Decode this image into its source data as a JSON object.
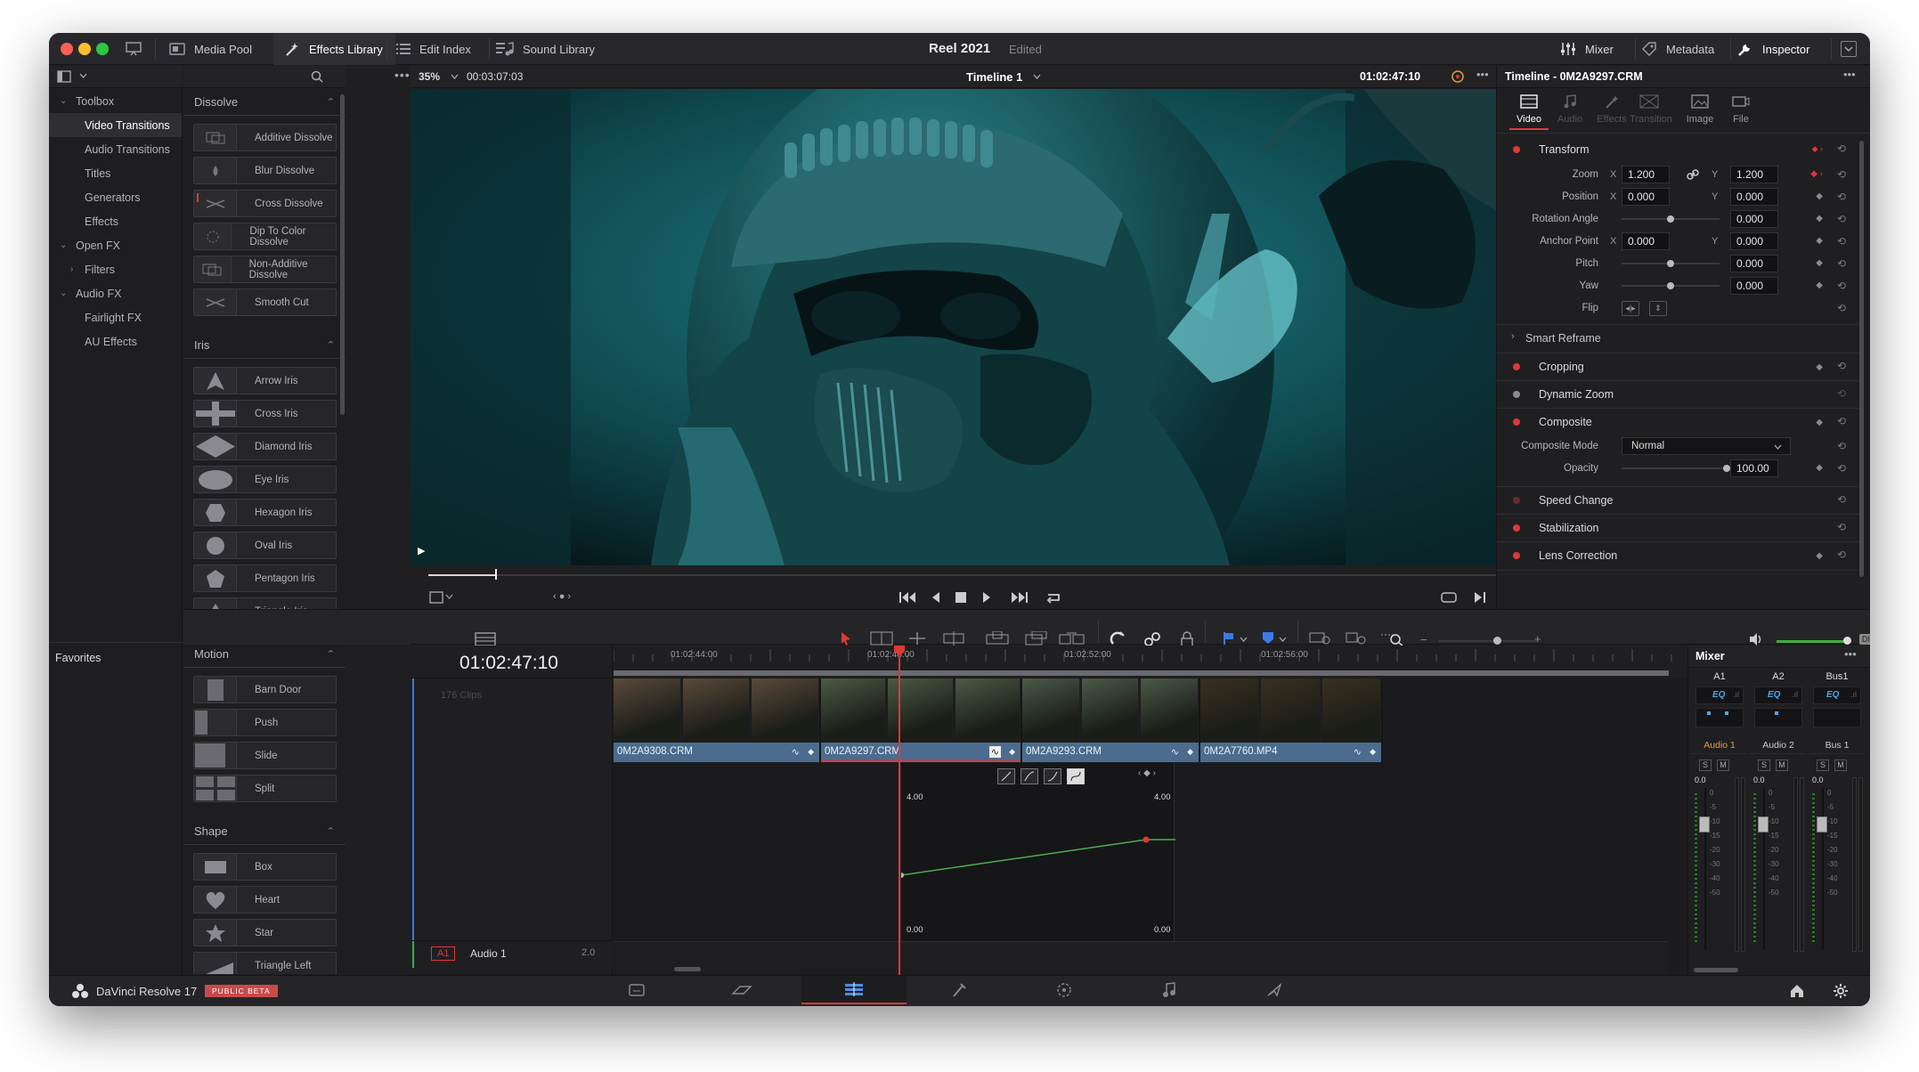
{
  "window": {
    "project_title": "Reel 2021",
    "status": "Edited",
    "toolbar_left": [
      {
        "label": "Media Pool",
        "icon": "media-pool-icon"
      },
      {
        "label": "Effects Library",
        "icon": "effects-wand-icon"
      },
      {
        "label": "Edit Index",
        "icon": "list-icon"
      },
      {
        "label": "Sound Library",
        "icon": "music-list-icon"
      }
    ],
    "toolbar_right": [
      {
        "label": "Mixer",
        "icon": "sliders-icon"
      },
      {
        "label": "Metadata",
        "icon": "tag-icon"
      },
      {
        "label": "Inspector",
        "icon": "wrench-icon"
      }
    ]
  },
  "toolbox": {
    "items": [
      {
        "label": "Toolbox",
        "level": 0,
        "expanded": true
      },
      {
        "label": "Video Transitions",
        "level": 1,
        "selected": true
      },
      {
        "label": "Audio Transitions",
        "level": 1
      },
      {
        "label": "Titles",
        "level": 1
      },
      {
        "label": "Generators",
        "level": 1
      },
      {
        "label": "Effects",
        "level": 1
      },
      {
        "label": "Open FX",
        "level": 0,
        "expanded": true
      },
      {
        "label": "Filters",
        "level": 1,
        "collapsed": true
      },
      {
        "label": "Audio FX",
        "level": 0,
        "expanded": true
      },
      {
        "label": "Fairlight FX",
        "level": 1
      },
      {
        "label": "AU Effects",
        "level": 1
      }
    ],
    "favorites_label": "Favorites"
  },
  "effects": {
    "groups": [
      {
        "title": "Dissolve",
        "items": [
          "Additive Dissolve",
          "Blur Dissolve",
          "Cross Dissolve",
          "Dip To Color Dissolve",
          "Non-Additive Dissolve",
          "Smooth Cut"
        ]
      },
      {
        "title": "Iris",
        "items": [
          "Arrow Iris",
          "Cross Iris",
          "Diamond Iris",
          "Eye Iris",
          "Hexagon Iris",
          "Oval Iris",
          "Pentagon Iris",
          "Triangle Iris"
        ]
      },
      {
        "title": "Motion",
        "items": [
          "Barn Door",
          "Push",
          "Slide",
          "Split"
        ]
      },
      {
        "title": "Shape",
        "items": [
          "Box",
          "Heart",
          "Star",
          "Triangle Left"
        ]
      }
    ]
  },
  "viewer": {
    "zoom": "35%",
    "duration": "00:03:07:03",
    "timeline_name": "Timeline 1",
    "timecode": "01:02:47:10",
    "scrub_position": 0.06
  },
  "inspector": {
    "title": "Timeline - 0M2A9297.CRM",
    "tabs": [
      {
        "label": "Video",
        "active": true,
        "icon": "film-icon"
      },
      {
        "label": "Audio",
        "icon": "note-icon"
      },
      {
        "label": "Effects",
        "icon": "wand-icon"
      },
      {
        "label": "Transition",
        "icon": "transition-icon"
      },
      {
        "label": "Image",
        "icon": "image-icon"
      },
      {
        "label": "File",
        "icon": "file-icon"
      }
    ],
    "transform": {
      "title": "Transform",
      "zoom_label": "Zoom",
      "zoom_x": "1.200",
      "zoom_y": "1.200",
      "position_label": "Position",
      "position_x": "0.000",
      "position_y": "0.000",
      "rotation_label": "Rotation Angle",
      "rotation": "0.000",
      "anchor_label": "Anchor Point",
      "anchor_x": "0.000",
      "anchor_y": "0.000",
      "pitch_label": "Pitch",
      "pitch": "0.000",
      "yaw_label": "Yaw",
      "yaw": "0.000",
      "flip_label": "Flip",
      "x_label": "X",
      "y_label": "Y"
    },
    "smart_reframe": "Smart Reframe",
    "sections": [
      {
        "label": "Cropping",
        "enabled": true
      },
      {
        "label": "Dynamic Zoom",
        "enabled": false
      },
      {
        "label": "Composite",
        "enabled": true
      }
    ],
    "composite_mode_label": "Composite Mode",
    "composite_mode": "Normal",
    "opacity_label": "Opacity",
    "opacity": "100.00",
    "sections2": [
      {
        "label": "Speed Change",
        "enabled": false
      },
      {
        "label": "Stabilization",
        "enabled": true
      },
      {
        "label": "Lens Correction",
        "enabled": true
      }
    ]
  },
  "timeline": {
    "timecode": "01:02:47:10",
    "clips_count": "176 Clips",
    "ruler_labels": [
      "01:02:44:00",
      "01:02:48:00",
      "01:02:52:00",
      "01:02:56:00"
    ],
    "clips": [
      {
        "name": "0M2A9308.CRM",
        "tone": "#5a4a3a"
      },
      {
        "name": "0M2A9297.CRM",
        "tone": "#4b5a45"
      },
      {
        "name": "0M2A9293.CRM",
        "tone": "#4a5a48"
      },
      {
        "name": "0M2A7760.MP4",
        "tone": "#3a3020"
      }
    ],
    "curve": {
      "top_left": "4.00",
      "top_right": "4.00",
      "bottom_left": "0.00",
      "bottom_right": "0.00"
    },
    "audio_track": {
      "id": "A1",
      "name": "Audio 1",
      "level": "2.0"
    }
  },
  "mixer": {
    "title": "Mixer",
    "channels": [
      {
        "id": "A1",
        "name": "Audio 1",
        "level": "0.0"
      },
      {
        "id": "A2",
        "name": "Audio 2",
        "level": "0.0"
      },
      {
        "id": "Bus1",
        "name": "Bus 1",
        "level": "0.0"
      }
    ],
    "eq_label": "EQ",
    "solo": "S",
    "mute": "M",
    "scale": [
      "0",
      "-5",
      "-10",
      "-15",
      "-20",
      "-30",
      "-40",
      "-50"
    ]
  },
  "app": {
    "name": "DaVinci Resolve 17",
    "badge": "PUBLIC BETA"
  },
  "colors": {
    "accent_red": "#e23b3b",
    "clip_blue": "#4b6c8e",
    "curve_green": "#4caf50"
  }
}
